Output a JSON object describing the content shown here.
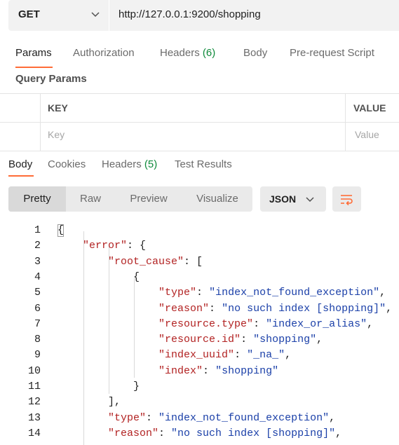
{
  "request": {
    "method": "GET",
    "url": "http://127.0.0.1:9200/shopping"
  },
  "request_tabs": [
    {
      "label": "Params",
      "count": "",
      "active": true
    },
    {
      "label": "Authorization",
      "count": "",
      "active": false
    },
    {
      "label": "Headers ",
      "count": "(6)",
      "active": false
    },
    {
      "label": "Body",
      "count": "",
      "active": false
    },
    {
      "label": "Pre-request Script",
      "count": "",
      "active": false
    }
  ],
  "query_params": {
    "title": "Query Params",
    "headers": [
      "KEY",
      "VALUE"
    ],
    "placeholders": {
      "key": "Key",
      "value": "Value"
    }
  },
  "response_tabs": [
    {
      "label": "Body",
      "count": "",
      "active": true
    },
    {
      "label": "Cookies",
      "count": "",
      "active": false
    },
    {
      "label": "Headers ",
      "count": "(5)",
      "active": false
    },
    {
      "label": "Test Results",
      "count": "",
      "active": false
    }
  ],
  "view_modes": [
    "Pretty",
    "Raw",
    "Preview",
    "Visualize"
  ],
  "active_view_mode": "Pretty",
  "format": "JSON",
  "colors": {
    "accent": "#ff6c37",
    "count_green": "#0f8a3b",
    "json_key": "#b22222",
    "json_string": "#1a3fa8"
  },
  "code_lines": [
    {
      "n": "1",
      "tokens": [
        {
          "t": "{",
          "c": "pun"
        }
      ]
    },
    {
      "n": "2",
      "tokens": [
        {
          "t": "    ",
          "c": "pun"
        },
        {
          "t": "\"error\"",
          "c": "key"
        },
        {
          "t": ": {",
          "c": "pun"
        }
      ]
    },
    {
      "n": "3",
      "tokens": [
        {
          "t": "        ",
          "c": "pun"
        },
        {
          "t": "\"root_cause\"",
          "c": "key"
        },
        {
          "t": ": [",
          "c": "pun"
        }
      ]
    },
    {
      "n": "4",
      "tokens": [
        {
          "t": "            {",
          "c": "pun"
        }
      ]
    },
    {
      "n": "5",
      "tokens": [
        {
          "t": "                ",
          "c": "pun"
        },
        {
          "t": "\"type\"",
          "c": "key"
        },
        {
          "t": ": ",
          "c": "pun"
        },
        {
          "t": "\"index_not_found_exception\"",
          "c": "str"
        },
        {
          "t": ",",
          "c": "pun"
        }
      ]
    },
    {
      "n": "6",
      "tokens": [
        {
          "t": "                ",
          "c": "pun"
        },
        {
          "t": "\"reason\"",
          "c": "key"
        },
        {
          "t": ": ",
          "c": "pun"
        },
        {
          "t": "\"no such index [shopping]\"",
          "c": "str"
        },
        {
          "t": ",",
          "c": "pun"
        }
      ]
    },
    {
      "n": "7",
      "tokens": [
        {
          "t": "                ",
          "c": "pun"
        },
        {
          "t": "\"resource.type\"",
          "c": "key"
        },
        {
          "t": ": ",
          "c": "pun"
        },
        {
          "t": "\"index_or_alias\"",
          "c": "str"
        },
        {
          "t": ",",
          "c": "pun"
        }
      ]
    },
    {
      "n": "8",
      "tokens": [
        {
          "t": "                ",
          "c": "pun"
        },
        {
          "t": "\"resource.id\"",
          "c": "key"
        },
        {
          "t": ": ",
          "c": "pun"
        },
        {
          "t": "\"shopping\"",
          "c": "str"
        },
        {
          "t": ",",
          "c": "pun"
        }
      ]
    },
    {
      "n": "9",
      "tokens": [
        {
          "t": "                ",
          "c": "pun"
        },
        {
          "t": "\"index_uuid\"",
          "c": "key"
        },
        {
          "t": ": ",
          "c": "pun"
        },
        {
          "t": "\"_na_\"",
          "c": "str"
        },
        {
          "t": ",",
          "c": "pun"
        }
      ]
    },
    {
      "n": "10",
      "tokens": [
        {
          "t": "                ",
          "c": "pun"
        },
        {
          "t": "\"index\"",
          "c": "key"
        },
        {
          "t": ": ",
          "c": "pun"
        },
        {
          "t": "\"shopping\"",
          "c": "str"
        }
      ]
    },
    {
      "n": "11",
      "tokens": [
        {
          "t": "            }",
          "c": "pun"
        }
      ]
    },
    {
      "n": "12",
      "tokens": [
        {
          "t": "        ],",
          "c": "pun"
        }
      ]
    },
    {
      "n": "13",
      "tokens": [
        {
          "t": "        ",
          "c": "pun"
        },
        {
          "t": "\"type\"",
          "c": "key"
        },
        {
          "t": ": ",
          "c": "pun"
        },
        {
          "t": "\"index_not_found_exception\"",
          "c": "str"
        },
        {
          "t": ",",
          "c": "pun"
        }
      ]
    },
    {
      "n": "14",
      "tokens": [
        {
          "t": "        ",
          "c": "pun"
        },
        {
          "t": "\"reason\"",
          "c": "key"
        },
        {
          "t": ": ",
          "c": "pun"
        },
        {
          "t": "\"no such index [shopping]\"",
          "c": "str"
        },
        {
          "t": ",",
          "c": "pun"
        }
      ]
    }
  ]
}
